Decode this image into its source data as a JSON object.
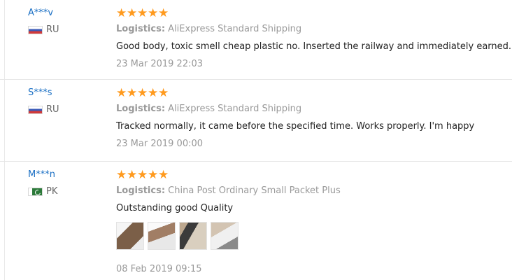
{
  "reviews": [
    {
      "buyer": "A***v",
      "country": "RU",
      "stars": [
        "★",
        "★",
        "★",
        "★",
        "★"
      ],
      "logistics_label": "Logistics:",
      "logistics_value": "AliExpress Standard Shipping",
      "comment": "Good body, toxic smell cheap plastic no. Inserted the railway and immediately earned.",
      "date": "23 Mar 2019 22:03"
    },
    {
      "buyer": "S***s",
      "country": "RU",
      "stars": [
        "★",
        "★",
        "★",
        "★",
        "★"
      ],
      "logistics_label": "Logistics:",
      "logistics_value": "AliExpress Standard Shipping",
      "comment": "Tracked normally, it came before the specified time. Works properly. I'm happy",
      "date": "23 Mar 2019 00:00"
    },
    {
      "buyer": "M***n",
      "country": "PK",
      "stars": [
        "★",
        "★",
        "★",
        "★",
        "★"
      ],
      "logistics_label": "Logistics:",
      "logistics_value": "China Post Ordinary Small Packet Plus",
      "comment": "Outstanding good Quality",
      "date": "08 Feb 2019 09:15"
    }
  ],
  "colors": {
    "star": "#ff9a1e",
    "buyer_link": "#1a6fc4",
    "muted_text": "#999999"
  },
  "icons": {
    "star": "star-icon",
    "flag_ru": "russia-flag-icon",
    "flag_pk": "pakistan-flag-icon"
  }
}
